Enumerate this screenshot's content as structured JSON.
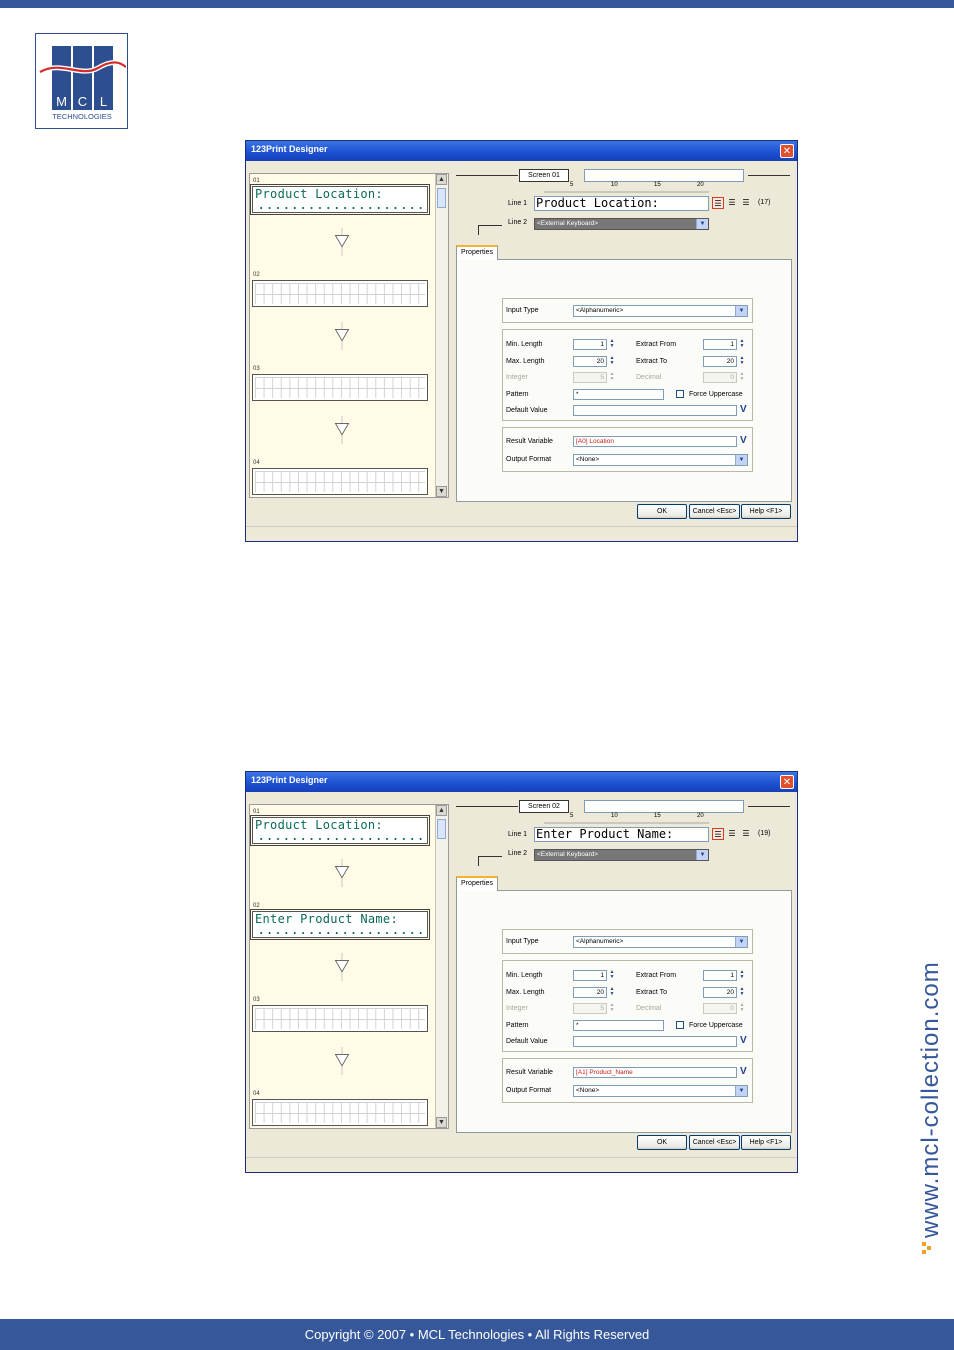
{
  "footer": {
    "copyright": "Copyright © 2007 • MCL Technologies • All Rights Reserved"
  },
  "brand": {
    "logo_initials": [
      "M",
      "C",
      "L"
    ],
    "logo_tagline": "TECHNOLOGIES",
    "side_url": "www.mcl-collection.com"
  },
  "dialogs": [
    {
      "title": "123Print Designer",
      "screens": [
        {
          "num": "01",
          "text": "Product Location:"
        },
        {
          "num": "02",
          "text": ""
        },
        {
          "num": "03",
          "text": ""
        },
        {
          "num": "04",
          "text": ""
        }
      ],
      "screen_label": "Screen 01",
      "ruler": [
        "5",
        "10",
        "15",
        "20"
      ],
      "line1_label": "Line 1",
      "line1_value": "Product Location:",
      "char_count": "(17)",
      "line2_label": "Line 2",
      "line2_value": "<External Keyboard>",
      "tab": "Properties",
      "input_type_label": "Input Type",
      "input_type": "<Alphanumeric>",
      "min_length_label": "Min. Length",
      "min_length": "1",
      "max_length_label": "Max. Length",
      "max_length": "20",
      "integer_label": "Integer",
      "integer": "5",
      "extract_from_label": "Extract From",
      "extract_from": "1",
      "extract_to_label": "Extract To",
      "extract_to": "20",
      "decimal_label": "Decimal",
      "decimal": "0",
      "pattern_label": "Pattern",
      "pattern": "*",
      "force_upper_label": "Force Uppercase",
      "default_value_label": "Default Value",
      "default_value": "",
      "result_var_label": "Result Variable",
      "result_var": "[A0] Location",
      "output_format_label": "Output Format",
      "output_format": "<None>",
      "ok": "OK",
      "cancel": "Cancel <Esc>",
      "help": "Help <F1>"
    },
    {
      "title": "123Print Designer",
      "screens": [
        {
          "num": "01",
          "text": "Product Location:"
        },
        {
          "num": "02",
          "text": "Enter Product Name:"
        },
        {
          "num": "03",
          "text": ""
        },
        {
          "num": "04",
          "text": ""
        }
      ],
      "screen_label": "Screen 02",
      "ruler": [
        "5",
        "10",
        "15",
        "20"
      ],
      "line1_label": "Line 1",
      "line1_value": "Enter Product Name:",
      "char_count": "(19)",
      "line2_label": "Line 2",
      "line2_value": "<External Keyboard>",
      "tab": "Properties",
      "input_type_label": "Input Type",
      "input_type": "<Alphanumeric>",
      "min_length_label": "Min. Length",
      "min_length": "1",
      "max_length_label": "Max. Length",
      "max_length": "20",
      "integer_label": "Integer",
      "integer": "5",
      "extract_from_label": "Extract From",
      "extract_from": "1",
      "extract_to_label": "Extract To",
      "extract_to": "20",
      "decimal_label": "Decimal",
      "decimal": "0",
      "pattern_label": "Pattern",
      "pattern": "*",
      "force_upper_label": "Force Uppercase",
      "default_value_label": "Default Value",
      "default_value": "",
      "result_var_label": "Result Variable",
      "result_var": "[A1] Product_Name",
      "output_format_label": "Output Format",
      "output_format": "<None>",
      "ok": "OK",
      "cancel": "Cancel <Esc>",
      "help": "Help <F1>"
    }
  ]
}
